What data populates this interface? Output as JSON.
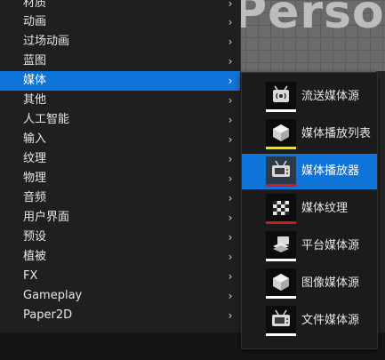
{
  "viewport": {
    "overlay_text": "Perso"
  },
  "menu": {
    "items": [
      {
        "label": "材质"
      },
      {
        "label": "动画"
      },
      {
        "label": "过场动画"
      },
      {
        "label": "蓝图"
      },
      {
        "label": "媒体",
        "selected": true
      },
      {
        "label": "其他"
      },
      {
        "label": "人工智能"
      },
      {
        "label": "输入"
      },
      {
        "label": "纹理"
      },
      {
        "label": "物理"
      },
      {
        "label": "音频"
      },
      {
        "label": "用户界面"
      },
      {
        "label": "预设"
      },
      {
        "label": "植被"
      },
      {
        "label": "FX"
      },
      {
        "label": "Gameplay"
      },
      {
        "label": "Paper2D"
      }
    ],
    "chevron": "›"
  },
  "submenu": {
    "items": [
      {
        "label": "流送媒体源",
        "icon": "stream-media-source-icon",
        "bar_color": "#ffffff"
      },
      {
        "label": "媒体播放列表",
        "icon": "media-playlist-icon",
        "bar_color": "#f2e600"
      },
      {
        "label": "媒体播放器",
        "icon": "media-player-icon",
        "bar_color": "#d11a1a",
        "selected": true
      },
      {
        "label": "媒体纹理",
        "icon": "media-texture-icon",
        "bar_color": "#d11a1a"
      },
      {
        "label": "平台媒体源",
        "icon": "platform-media-source-icon",
        "bar_color": "#ffffff"
      },
      {
        "label": "图像媒体源",
        "icon": "image-media-source-icon",
        "bar_color": "#ffffff"
      },
      {
        "label": "文件媒体源",
        "icon": "file-media-source-icon",
        "bar_color": "#ffffff"
      }
    ]
  },
  "colors": {
    "selection": "#0f74d9",
    "menu_bg": "#1f1f1f"
  }
}
